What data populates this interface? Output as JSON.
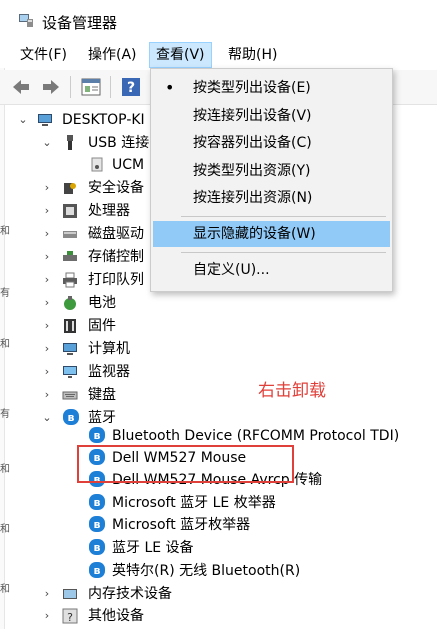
{
  "window": {
    "title": "设备管理器"
  },
  "menubar": {
    "file": "文件(F)",
    "action": "操作(A)",
    "view": "查看(V)",
    "help": "帮助(H)"
  },
  "view_menu": {
    "items": [
      "按类型列出设备(E)",
      "按连接列出设备(V)",
      "按容器列出设备(C)",
      "按类型列出资源(Y)",
      "按连接列出资源(N)",
      "显示隐藏的设备(W)",
      "自定义(U)..."
    ],
    "checked_index": 0,
    "highlighted_index": 5,
    "bullet": "•"
  },
  "tree": {
    "root": "DESKTOP-KI",
    "usb_group": "USB 连接",
    "usb_child": "UCM",
    "categories_a": [
      "安全设备",
      "处理器",
      "磁盘驱动",
      "存储控制",
      "打印队列",
      "电池",
      "固件",
      "计算机",
      "监视器",
      "键盘"
    ],
    "bluetooth": "蓝牙",
    "bluetooth_devices": [
      "Bluetooth Device (RFCOMM Protocol TDI)",
      "Dell WM527 Mouse",
      "Dell WM527 Mouse Avrcp 传输",
      "Microsoft 蓝牙 LE 枚举器",
      "Microsoft 蓝牙枚举器",
      "蓝牙 LE 设备",
      "英特尔(R) 无线 Bluetooth(R)"
    ],
    "categories_b": [
      "内存技术设备",
      "其他设备"
    ]
  },
  "annotation": {
    "text": "右击卸载"
  },
  "edge_marks": [
    "和",
    "有",
    "和",
    "有",
    "和",
    "和",
    "和"
  ],
  "colors": {
    "menu_highlight": "#91c9f7",
    "annotation": "#e0403a",
    "bluetooth": "#1e7fd6"
  }
}
